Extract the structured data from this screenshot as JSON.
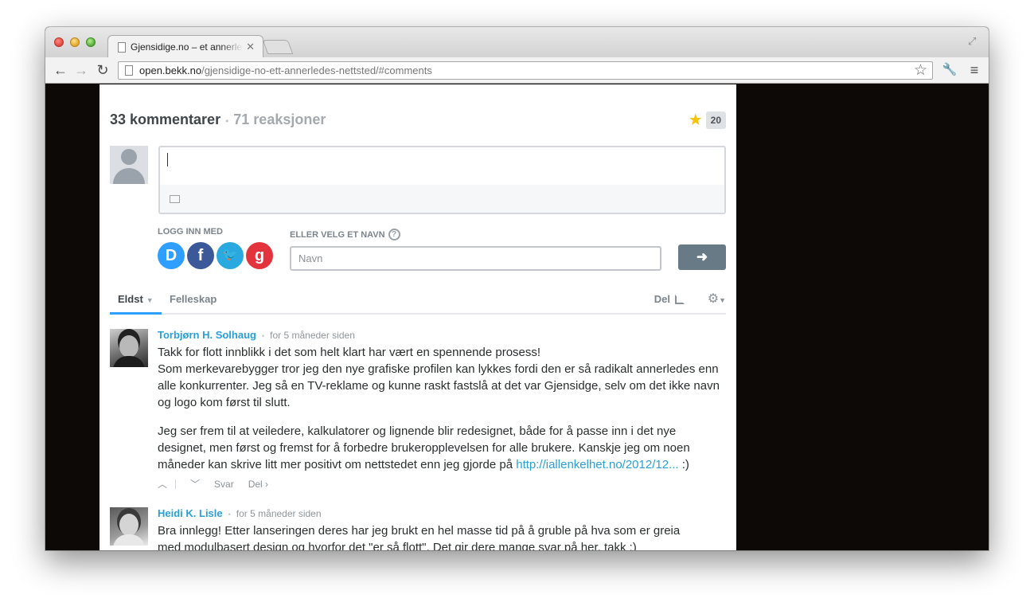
{
  "browser": {
    "tab_title": "Gjensidige.no – et annerledes nettsted",
    "tab_close": "✕",
    "url_host": "open.bekk.no",
    "url_path": "/gjensidige-no-ett-annerledes-nettsted/#comments",
    "back_icon": "←",
    "forward_icon": "→",
    "reload_icon": "↻",
    "bookmark_icon": "☆",
    "wrench_icon": "🔧",
    "menu_icon": "≡",
    "fullscreen_icon": "⤢"
  },
  "disqus": {
    "comment_count": "33 kommentarer",
    "reaction_count": "71 reaksjoner",
    "favorite_star": "★",
    "favorite_count": "20",
    "login_label": "LOGG INN MED",
    "social": {
      "disqus": "D",
      "facebook": "f",
      "twitter": "🐦",
      "google": "g"
    },
    "guest_label": "ELLER VELG ET NAVN",
    "help_icon": "?",
    "name_placeholder": "Navn",
    "submit_icon": "➜",
    "sort_active": "Eldst",
    "sort_other": "Felleskap",
    "share_label": "Del",
    "gear_icon": "⚙",
    "caret_down": "▼"
  },
  "comments": [
    {
      "author": "Torbjørn H. Solhaug",
      "time": "for 5 måneder siden",
      "paragraphs": [
        "Takk for flott innblikk i det som helt klart har vært en spennende prosess!\nSom merkevarebygger tror jeg den nye grafiske profilen kan lykkes fordi den er så radikalt annerledes enn alle konkurrenter. Jeg så en TV-reklame og kunne raskt fastslå at det var Gjensidge, selv om det ikke navn og logo kom først til slutt.",
        "Jeg ser frem til at veiledere, kalkulatorer og lignende blir redesignet, både for å passe inn i det nye designet, men først og fremst for å forbedre brukeropplevelsen for alle brukere. Kanskje jeg om noen måneder kan skrive litt mer positivt om nettstedet enn jeg gjorde på "
      ],
      "link": "http://iallenkelhet.no/2012/12...",
      "after_link": " :)",
      "upvote_icon": "︿",
      "downvote_icon": "﹀",
      "reply": "Svar",
      "share": "Del ›"
    },
    {
      "author": "Heidi K. Lisle",
      "time": "for 5 måneder siden",
      "paragraphs": [
        "Bra innlegg! Etter lanseringen deres har jeg brukt en hel masse tid på å gruble på hva som er greia\nmed modulbasert design og hvorfor det \"er så flott\". Det gir dere mange svar på her, takk :)"
      ]
    }
  ],
  "separator_dot": "•"
}
